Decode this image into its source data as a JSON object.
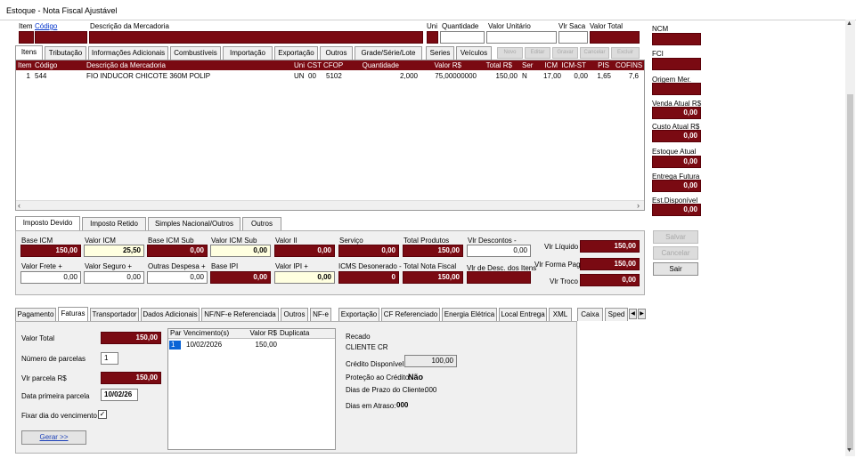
{
  "window": {
    "title": "Estoque - Nota Fiscal Ajustável"
  },
  "header_fields": {
    "item": "Item",
    "codigo": "Código",
    "descricao": "Descrição da Mercadoria",
    "uni": "Uni",
    "quantidade": "Quantidade",
    "valor_unitario": "Valor Unitário",
    "vlr_saca": "Vlr Saca",
    "valor_total": "Valor Total"
  },
  "item_tabs": [
    "Itens",
    "Tributação",
    "Informações Adicionais",
    "Combustíveis",
    "Importação",
    "Exportação",
    "Outros",
    "Grade/Série/Lote",
    "Series",
    "Veículos"
  ],
  "item_buttons": [
    "Novo",
    "Editar",
    "Gravar",
    "Cancelar",
    "Excluir"
  ],
  "grid": {
    "columns": [
      "Item",
      "Código",
      "Descrição da Mercadoria",
      "Uni",
      "CST",
      "CFOP",
      "Quantidade",
      "Valor R$",
      "Total R$",
      "Ser",
      "ICM",
      "ICM-ST",
      "PIS",
      "COFINS"
    ],
    "rows": [
      [
        "1",
        "544",
        "FIO INDUCOR CHICOTE 360M POLIP",
        "UN",
        "00",
        "5102",
        "2,000",
        "75,00000000",
        "150,00",
        "N",
        "17,00",
        "0,00",
        "1,65",
        "7,6"
      ]
    ]
  },
  "sidebar": {
    "ncm": "NCM",
    "fci": "FCI",
    "origem": "Origem Mer.",
    "venda_label": "Venda Atual R$",
    "venda_value": "0,00",
    "custo_label": "Custo Atual R$",
    "custo_value": "0,00",
    "estoque_label": "Estoque Atual",
    "estoque_value": "0,00",
    "entrega_label": "Entrega Futura",
    "entrega_value": "0,00",
    "disponivel_label": "Est.Disponível",
    "disponivel_value": "0,00",
    "btn_salvar": "Salvar",
    "btn_cancelar": "Cancelar",
    "btn_sair": "Sair"
  },
  "tax_tabs": [
    "Imposto Devido",
    "Imposto Retido",
    "Simples Nacional/Outros",
    "Outros"
  ],
  "taxes": {
    "base_icm_l": "Base ICM",
    "base_icm": "150,00",
    "valor_icm_l": "Valor ICM",
    "valor_icm": "25,50",
    "base_icm_sub_l": "Base ICM Sub",
    "base_icm_sub": "0,00",
    "valor_icm_sub_l": "Valor ICM Sub",
    "valor_icm_sub": "0,00",
    "valor_ii_l": "Valor II",
    "valor_ii": "0,00",
    "servico_l": "Serviço",
    "servico": "0,00",
    "total_produtos_l": "Total Produtos",
    "total_produtos": "150,00",
    "vlr_descontos_l": "Vlr Descontos -",
    "vlr_descontos": "0,00",
    "vlr_liquido_l": "Vlr Líquido",
    "vlr_liquido": "150,00",
    "valor_frete_l": "Valor Frete +",
    "valor_frete": "0,00",
    "valor_seguro_l": "Valor Seguro +",
    "valor_seguro": "0,00",
    "outras_despesa_l": "Outras Despesa +",
    "outras_despesa": "0,00",
    "base_ipi_l": "Base IPI",
    "base_ipi": "0,00",
    "valor_ipi_l": "Valor IPI +",
    "valor_ipi": "0,00",
    "icms_desonerado_l": "ICMS Desonerado -",
    "icms_desonerado": "0",
    "total_nota_l": "Total Nota Fiscal",
    "total_nota": "150,00",
    "vlr_desc_itens_l": "Vlr de Desc. dos Itens",
    "vlr_desc_itens": "",
    "vlr_forma_pag_l": "Vlr Forma Pag",
    "vlr_forma_pag": "150,00",
    "vlr_troco_l": "Vlr Troco",
    "vlr_troco": "0,00"
  },
  "bottom_tabs": [
    "Pagamento",
    "Faturas",
    "Transportador",
    "Dados Adicionais",
    "NF/NF-e Referenciada",
    "Outros",
    "NF-e",
    "Exportação",
    "CF Referenciado",
    "Energia Elétrica",
    "Local Entrega",
    "XML",
    "Caixa",
    "Sped"
  ],
  "faturas": {
    "valor_total_l": "Valor Total",
    "valor_total": "150,00",
    "num_parcelas_l": "Número de parcelas",
    "num_parcelas": "1",
    "vlr_parcela_l": "Vlr parcela R$",
    "vlr_parcela": "150,00",
    "data_primeira_l": "Data primeira parcela",
    "data_primeira": "10/02/26",
    "fixar_dia_l": "Fixar dia do vencimento",
    "gerar": "Gerar >>",
    "table_columns": [
      "Par",
      "Vencimento(s)",
      "Valor R$",
      "Duplicata"
    ],
    "table_rows": [
      [
        "1",
        "10/02/2026",
        "150,00",
        ""
      ]
    ]
  },
  "credit": {
    "recado_l": "Recado",
    "recado": "CLIENTE CR",
    "credito_l": "Crédito Disponível:",
    "credito": "100,00",
    "protecao_l": "Proteção ao Crédito:",
    "protecao": "Não",
    "prazo_l": "Dias de Prazo do Cliente:",
    "prazo": "000",
    "atraso_l": "Dias em Atraso:",
    "atraso": "000"
  }
}
